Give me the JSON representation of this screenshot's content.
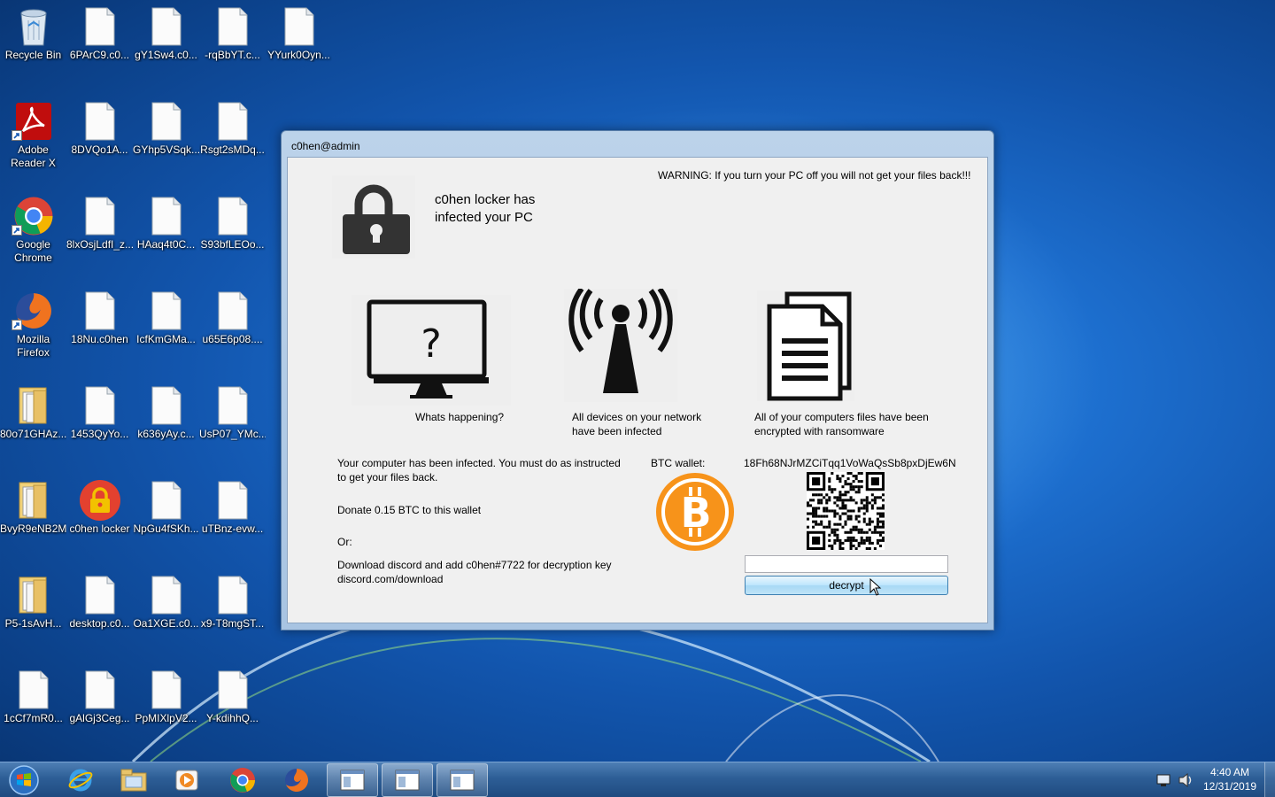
{
  "desktop": {
    "icons": [
      {
        "label": "Recycle Bin",
        "type": "recycle-bin"
      },
      {
        "label": "6PArC9.c0...",
        "type": "file"
      },
      {
        "label": "gY1Sw4.c0...",
        "type": "file"
      },
      {
        "label": "-rqBbYT.c...",
        "type": "file"
      },
      {
        "label": "YYurk0Oyn...",
        "type": "file"
      },
      {
        "label": "Adobe Reader X",
        "type": "adobe"
      },
      {
        "label": "8DVQo1A...",
        "type": "file"
      },
      {
        "label": "GYhp5VSqk...",
        "type": "file"
      },
      {
        "label": "Rsgt2sMDq...",
        "type": "file"
      },
      {
        "label": "Google Chrome",
        "type": "chrome"
      },
      {
        "label": "8lxOsjLdfI_z...",
        "type": "file"
      },
      {
        "label": "HAaq4t0C...",
        "type": "file"
      },
      {
        "label": "S93bfLEOo...",
        "type": "file"
      },
      {
        "label": "Mozilla Firefox",
        "type": "firefox"
      },
      {
        "label": "18Nu.c0hen",
        "type": "file"
      },
      {
        "label": "IcfKmGMa...",
        "type": "file"
      },
      {
        "label": "u65E6p08....",
        "type": "file"
      },
      {
        "label": "80o71GHAz...",
        "type": "folder"
      },
      {
        "label": "1453QyYo...",
        "type": "file"
      },
      {
        "label": "k636yAy.c...",
        "type": "file"
      },
      {
        "label": "UsP07_YMc...",
        "type": "file"
      },
      {
        "label": "BvyR9eNB2M",
        "type": "folder"
      },
      {
        "label": "c0hen locker",
        "type": "locker"
      },
      {
        "label": "NpGu4fSKh...",
        "type": "file"
      },
      {
        "label": "uTBnz-evw...",
        "type": "file"
      },
      {
        "label": "P5-1sAvH...",
        "type": "folder"
      },
      {
        "label": "desktop.c0...",
        "type": "file"
      },
      {
        "label": "Oa1XGE.c0...",
        "type": "file"
      },
      {
        "label": "x9-T8mgST...",
        "type": "file"
      },
      {
        "label": "1cCf7mR0...",
        "type": "file"
      },
      {
        "label": "gAlGj3Ceg...",
        "type": "file"
      },
      {
        "label": "PpMIXlpV2...",
        "type": "file"
      },
      {
        "label": "Y-kdihhQ...",
        "type": "file"
      }
    ]
  },
  "window": {
    "title": "c0hen@admin",
    "warning": "WARNING: If you turn your PC off you will not get your files back!!!",
    "headline_line1": "c0hen locker has",
    "headline_line2": "infected your PC",
    "panel1_caption": "Whats happening?",
    "panel2_caption_line1": "All devices on your network",
    "panel2_caption_line2": "have been infected",
    "panel3_caption_line1": "All of your computers files have been",
    "panel3_caption_line2": "encrypted with ransomware",
    "instructions_line1": "Your computer has been infected. You must do as instructed",
    "instructions_line2": "to get your files back.",
    "donate_text": "Donate 0.15 BTC to this wallet",
    "or_text": "Or:",
    "discord_line1": "Download discord and add c0hen#7722 for decryption key",
    "discord_line2": "discord.com/download",
    "btc_label": "BTC wallet:",
    "btc_address": "18Fh68NJrMZCiTqq1VoWaQsSb8pxDjEw6N",
    "decrypt_input_value": "",
    "decrypt_button_label": "decrypt"
  },
  "taskbar": {
    "pinned": [
      "start-orb-icon",
      "internet-explorer-icon",
      "file-explorer-icon",
      "media-player-icon",
      "chrome-icon",
      "firefox-icon"
    ],
    "open_windows": [
      "window-app-icon",
      "window-app-icon",
      "window-app-icon"
    ],
    "clock_time": "4:40 AM",
    "clock_date": "12/31/2019"
  },
  "colors": {
    "bitcoin_orange": "#f7931a",
    "window_frame": "#bcd3ea",
    "taskbar": "#2d5e96"
  }
}
